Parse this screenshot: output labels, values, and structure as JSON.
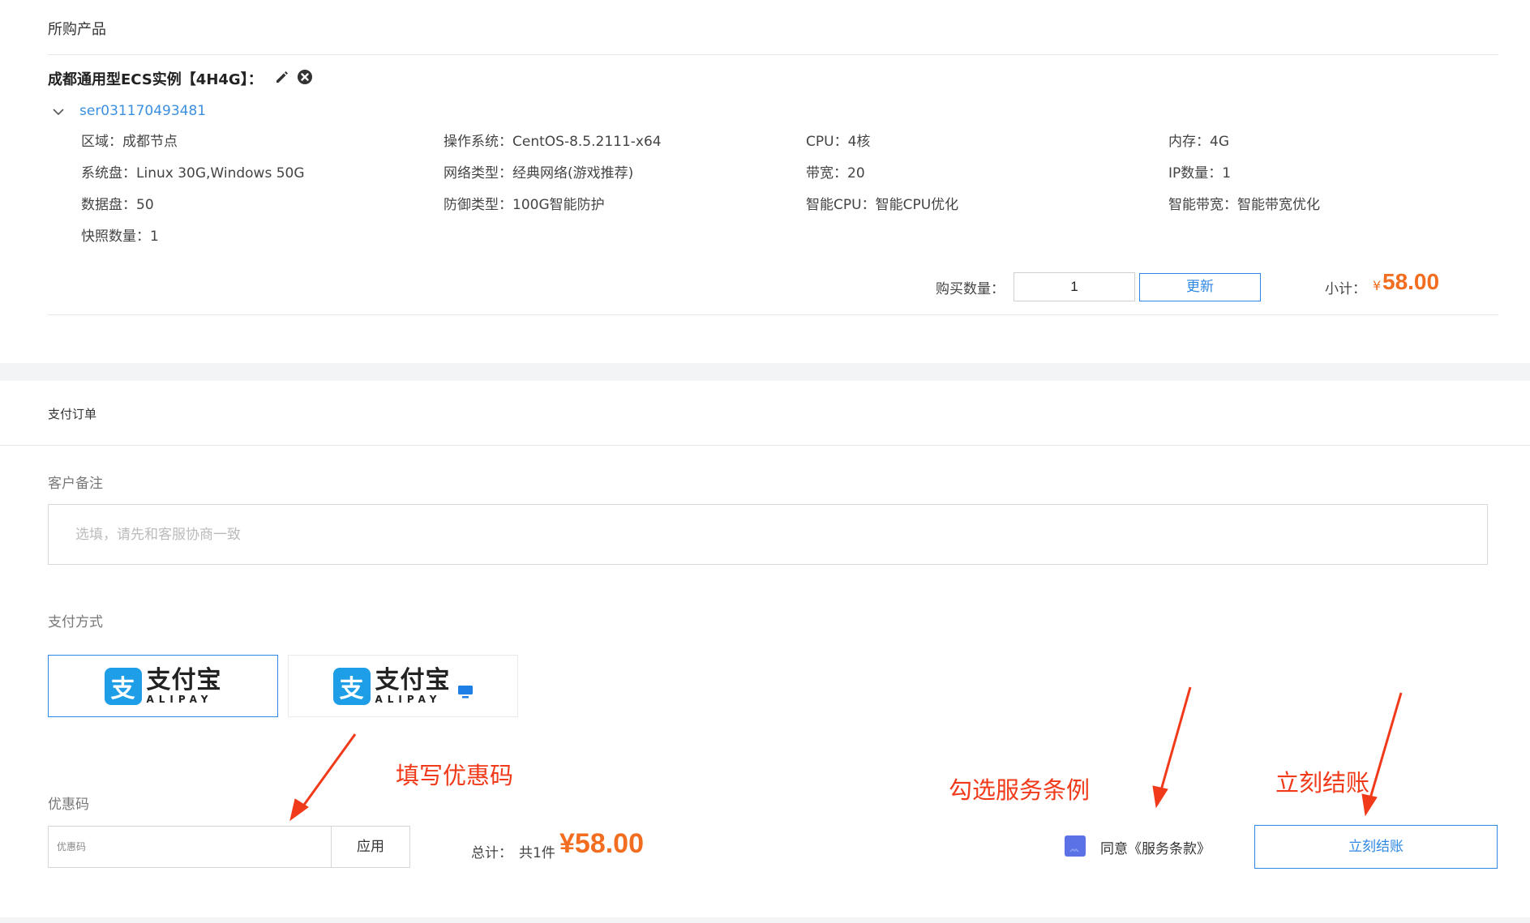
{
  "products": {
    "section_title": "所购产品",
    "product_title": "成都通用型ECS实例【4H4G】：",
    "server_id": "ser031170493481",
    "specs": [
      {
        "label": "区域：",
        "value": "成都节点"
      },
      {
        "label": "操作系统：",
        "value": "CentOS-8.5.2111-x64"
      },
      {
        "label": "CPU：",
        "value": "4核"
      },
      {
        "label": "内存：",
        "value": "4G"
      },
      {
        "label": "系统盘：",
        "value": "Linux 30G,Windows 50G"
      },
      {
        "label": "网络类型：",
        "value": "经典网络(游戏推荐)"
      },
      {
        "label": "带宽：",
        "value": "20"
      },
      {
        "label": "IP数量：",
        "value": "1"
      },
      {
        "label": "数据盘：",
        "value": "50"
      },
      {
        "label": "防御类型：",
        "value": "100G智能防护"
      },
      {
        "label": "智能CPU：",
        "value": "智能CPU优化"
      },
      {
        "label": "智能带宽：",
        "value": "智能带宽优化"
      },
      {
        "label": "快照数量：",
        "value": "1"
      }
    ],
    "quantity_label": "购买数量：",
    "quantity_value": "1",
    "update_label": "更新",
    "subtotal_label": "小计：",
    "subtotal_currency": "¥",
    "subtotal_value": "58.00",
    "edit_icon": "pencil-icon",
    "remove_icon": "close-circle-icon"
  },
  "payment": {
    "section_title": "支付订单",
    "remark_label": "客户备注",
    "remark_placeholder": "选填，请先和客服协商一致",
    "method_label": "支付方式",
    "methods": [
      {
        "cn": "支付宝",
        "en": "ALIPAY",
        "mark": "支",
        "selected": true
      },
      {
        "cn": "支付宝",
        "en": "ALIPAY",
        "mark": "支",
        "selected": false,
        "badge": "pc-icon"
      }
    ],
    "coupon_label": "优惠码",
    "coupon_placeholder": "优惠码",
    "apply_label": "应用",
    "total_label": "总计：",
    "total_count": "共1件",
    "total_value": "¥58.00",
    "agree_label": "同意《服务条款》",
    "checkout_label": "立刻结账"
  },
  "annotations": {
    "coupon_note": "填写优惠码",
    "terms_note": "勾选服务条例",
    "checkout_note": "立刻结账"
  },
  "colors": {
    "accent_blue": "#2d87e3",
    "link_blue": "#3b8fe0",
    "price_orange": "#f26d1f",
    "annotation_red": "#f03a1a",
    "checkbox_purple": "#5b72e6"
  }
}
